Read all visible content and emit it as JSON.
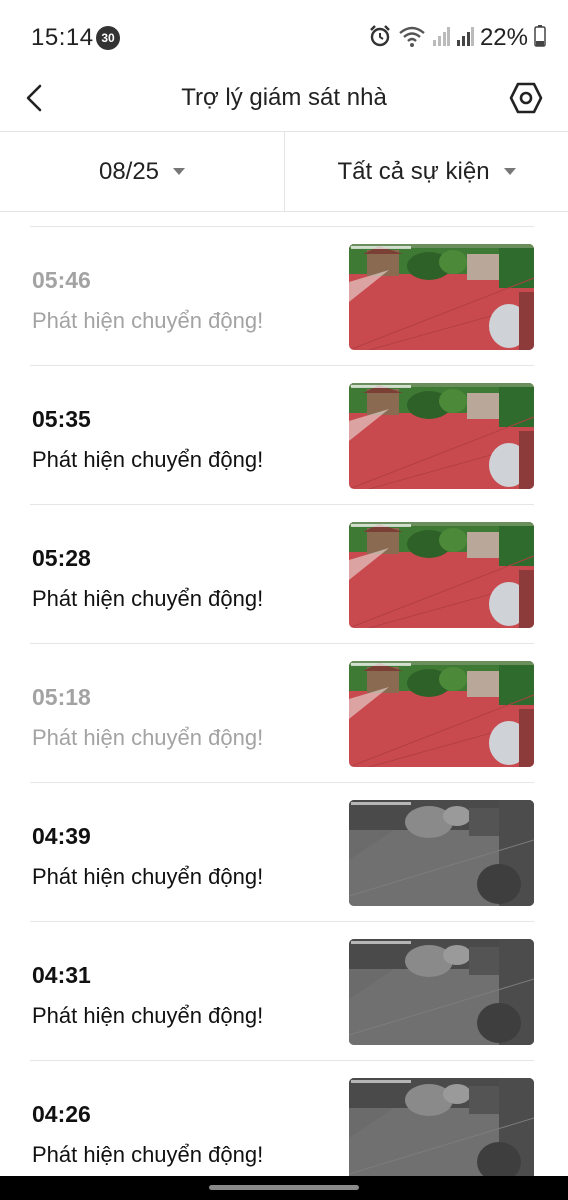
{
  "status_bar": {
    "time": "15:14",
    "notification_count": "30",
    "battery": "22%",
    "icons": [
      "alarm-icon",
      "wifi-icon",
      "signal-icon",
      "signal-icon",
      "battery-icon"
    ]
  },
  "header": {
    "title": "Trợ lý giám sát nhà",
    "back_icon": "chevron-left-icon",
    "settings_icon": "hexagon-settings-icon"
  },
  "filters": {
    "date": "08/25",
    "event_type": "Tất cả sự kiện"
  },
  "events": [
    {
      "time": "05:46",
      "description": "Phát hiện chuyển động!",
      "seen": true,
      "thumbnail": "day"
    },
    {
      "time": "05:35",
      "description": "Phát hiện chuyển động!",
      "seen": false,
      "thumbnail": "day"
    },
    {
      "time": "05:28",
      "description": "Phát hiện chuyển động!",
      "seen": false,
      "thumbnail": "day"
    },
    {
      "time": "05:18",
      "description": "Phát hiện chuyển động!",
      "seen": true,
      "thumbnail": "day"
    },
    {
      "time": "04:39",
      "description": "Phát hiện chuyển động!",
      "seen": false,
      "thumbnail": "night"
    },
    {
      "time": "04:31",
      "description": "Phát hiện chuyển động!",
      "seen": false,
      "thumbnail": "night"
    },
    {
      "time": "04:26",
      "description": "Phát hiện chuyển động!",
      "seen": false,
      "thumbnail": "night"
    }
  ],
  "colors": {
    "text_primary": "#111111",
    "text_seen": "#a3a3a3",
    "divider": "#e4e4e4",
    "floor_day": "#c94a4e",
    "foliage_day": "#3f7a34",
    "night_base": "#5c5c5c"
  }
}
